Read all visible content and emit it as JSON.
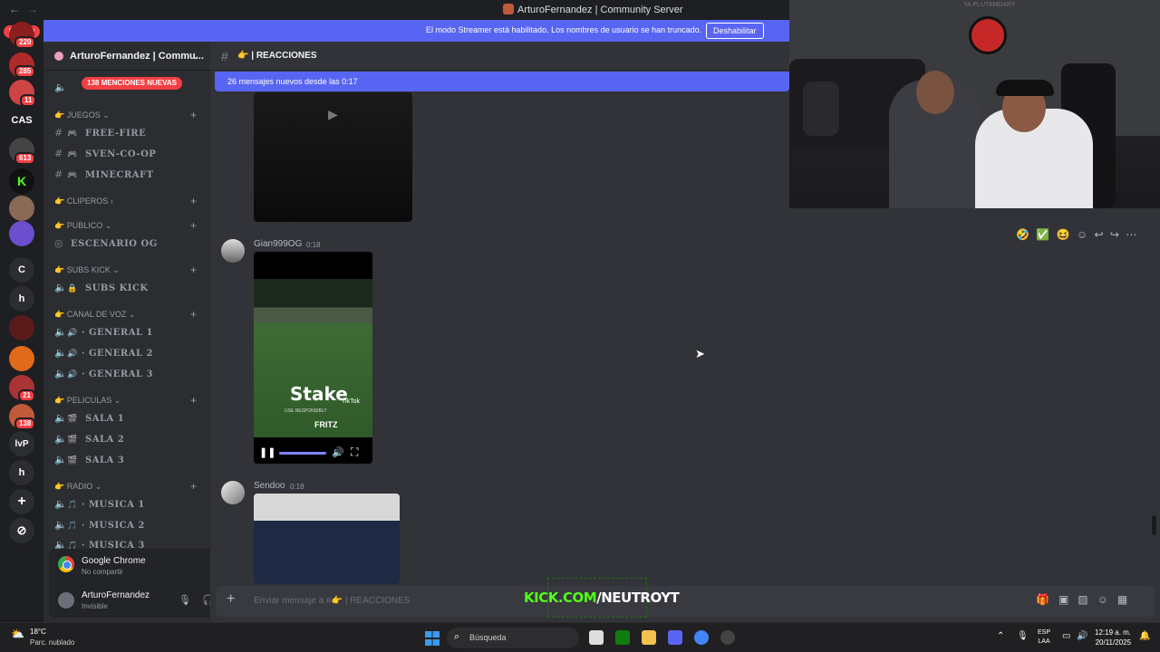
{
  "window": {
    "title": "ArturoFernandez | Community Server"
  },
  "streamer_banner": {
    "text": "El modo Streamer está habilitado. Los nombres de usuario se han truncado.",
    "button": "Deshabilitar"
  },
  "rail": {
    "nuevo_badge": "NUEVO",
    "badges": [
      "220",
      "285",
      "11",
      "613",
      "21",
      "138"
    ],
    "letters": [
      "CAS",
      "C",
      "h",
      "lvP",
      "h"
    ]
  },
  "server": {
    "name": "ArturoFernandez | Commu...",
    "mentions_pill": "138 MENCIONES NUEVAS"
  },
  "categories": [
    {
      "label": "JUEGOS",
      "emoji": "👉"
    },
    {
      "label": "CLIPEROS",
      "emoji": "👉"
    },
    {
      "label": "PUBLICO",
      "emoji": "👉"
    },
    {
      "label": "SUBS KICK",
      "emoji": "👉"
    },
    {
      "label": "CANAL DE VOZ",
      "emoji": "👉"
    },
    {
      "label": "PELICULAS",
      "emoji": "👉"
    },
    {
      "label": "RADIO",
      "emoji": "👉"
    }
  ],
  "channels": {
    "free_fire": "FREE-FIRE",
    "sven": "SVEN-CO-OP",
    "minecraft": "MINECRAFT",
    "escenario": "ESCENARIO OG",
    "subs_kick": "SUBS KICK",
    "general1": "GENERAL 1",
    "general2": "GENERAL 2",
    "general3": "GENERAL 3",
    "sala1": "SALA 1",
    "sala2": "SALA 2",
    "sala3": "SALA 3",
    "musica1": "MUSICA 1",
    "musica2": "MUSICA 2",
    "musica3": "MUSICA 3"
  },
  "user_panel": {
    "app": "Google Chrome",
    "app_status": "No compartir",
    "username": "ArturoFernandez",
    "status": "Invisible"
  },
  "chat": {
    "channel_name": "REACCIONES",
    "new_messages": "26 mensajes nuevos desde las 0:17",
    "messages": [
      {
        "author": "Gian999OG",
        "time": "0:18"
      },
      {
        "author": "Sendoo",
        "time": "0:18"
      }
    ],
    "video": {
      "brand": "Stake",
      "tiktok": "TikTok",
      "responsibly": "USE RESPONSIBLY",
      "sponsor": "FRITZ"
    },
    "composer_placeholder": "Enviar mensaje a #👉 | REACCIONES",
    "composer_channel": "REACCIONES"
  },
  "overlay": {
    "kick_prefix": "KICK.COM",
    "kick_suffix": "/NEUTROYT",
    "cam_logo_text": "YA PLUTAMDARY"
  },
  "taskbar": {
    "temperature": "18°C",
    "condition": "Parc. nublado",
    "search": "Búsqueda",
    "lang_top": "ESP",
    "lang_bottom": "LAA",
    "time": "12:19 a. m.",
    "date": "20/11/2025"
  },
  "colors": {
    "blurple": "#5865f2",
    "red": "#f23f43",
    "kick_green": "#53fc18"
  }
}
